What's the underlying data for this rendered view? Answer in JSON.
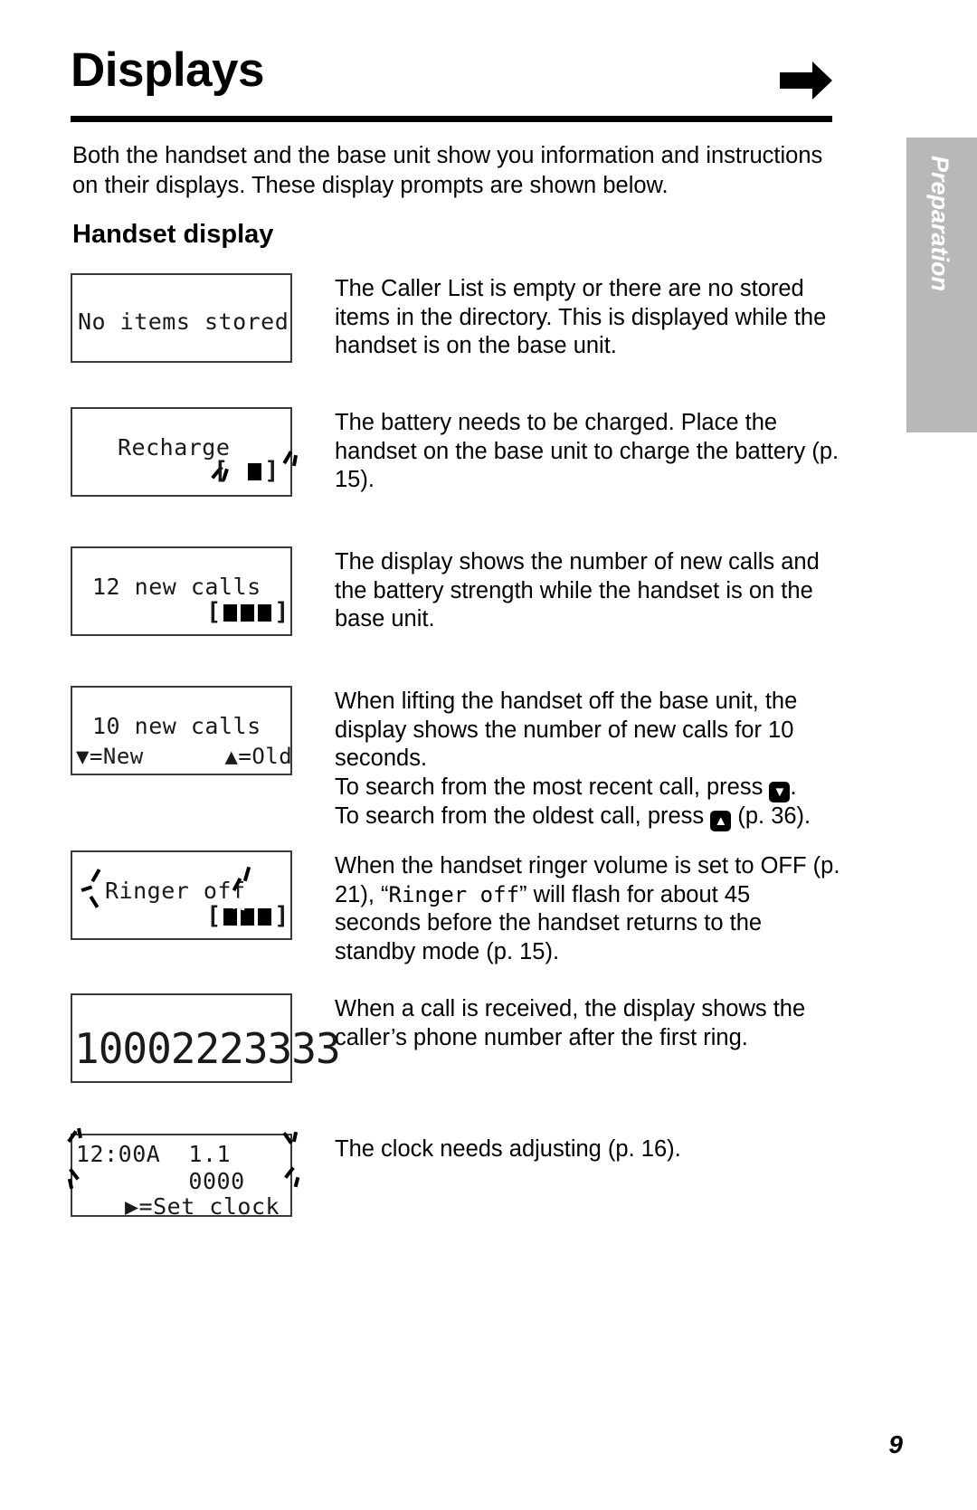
{
  "header": {
    "title": "Displays",
    "arrow_icon": "right-arrow-icon"
  },
  "intro": "Both the handset and the base unit show you information and instructions on their displays. These display prompts are shown below.",
  "section_heading": "Handset display",
  "side_tab": {
    "label": "Preparation",
    "bg_color": "#b8b8b8",
    "text_color": "#ffffff"
  },
  "rows": [
    {
      "id": "no-items-stored",
      "lcd_lines": [
        "No items stored"
      ],
      "battery": null,
      "flash": false,
      "description": "The Caller List is empty or there are no stored items in the directory. This is displayed while the handset is on the base unit."
    },
    {
      "id": "recharge",
      "lcd_lines": [
        "Recharge"
      ],
      "battery": {
        "filled": 1,
        "total": 1,
        "pattern": "low"
      },
      "flash": true,
      "description_parts": [
        {
          "type": "text",
          "value": "The battery needs to be charged. Place the handset on the base unit to charge the battery (p. 15)."
        }
      ]
    },
    {
      "id": "twelve-new-calls",
      "lcd_lines": [
        "12 new calls"
      ],
      "battery": {
        "filled": 3,
        "total": 3,
        "pattern": "full"
      },
      "flash": false,
      "description": "The display shows the number of new calls and the battery strength while the handset is on the base unit."
    },
    {
      "id": "ten-new-calls",
      "lcd_lines": [
        "10 new calls",
        "▼=New      ▲=Old"
      ],
      "battery": null,
      "flash": false,
      "description_parts": [
        {
          "type": "text",
          "value": "When lifting the handset off the base unit, the display shows the number of new calls for 10 seconds."
        },
        {
          "type": "break"
        },
        {
          "type": "text",
          "value": "To search from the most recent call, press "
        },
        {
          "type": "keycap",
          "value": "▼"
        },
        {
          "type": "text",
          "value": "."
        },
        {
          "type": "break"
        },
        {
          "type": "text",
          "value": "To search from the oldest call, press "
        },
        {
          "type": "keycap",
          "value": "▲"
        },
        {
          "type": "text",
          "value": " (p. 36)."
        }
      ]
    },
    {
      "id": "ringer-off",
      "lcd_lines": [
        "Ringer off"
      ],
      "battery": {
        "filled": 3,
        "total": 3,
        "pattern": "full-flash"
      },
      "flash": true,
      "description_parts": [
        {
          "type": "text",
          "value": "When the handset ringer volume is set to OFF (p. 21), “"
        },
        {
          "type": "mono",
          "value": "Ringer off"
        },
        {
          "type": "text",
          "value": "” will flash for about 45 seconds before the handset returns to the standby mode (p. 15)."
        }
      ]
    },
    {
      "id": "caller-number",
      "lcd_lines": [
        "10002223333"
      ],
      "battery": null,
      "flash": false,
      "description": "When a call is received, the display shows the caller’s phone number after the first ring."
    },
    {
      "id": "set-clock",
      "lcd_lines": [
        "12:00A  1.1",
        "        0000",
        "▶=Set clock"
      ],
      "battery": null,
      "flash": true,
      "description": "The clock needs adjusting (p. 16)."
    }
  ],
  "page_number": "9"
}
